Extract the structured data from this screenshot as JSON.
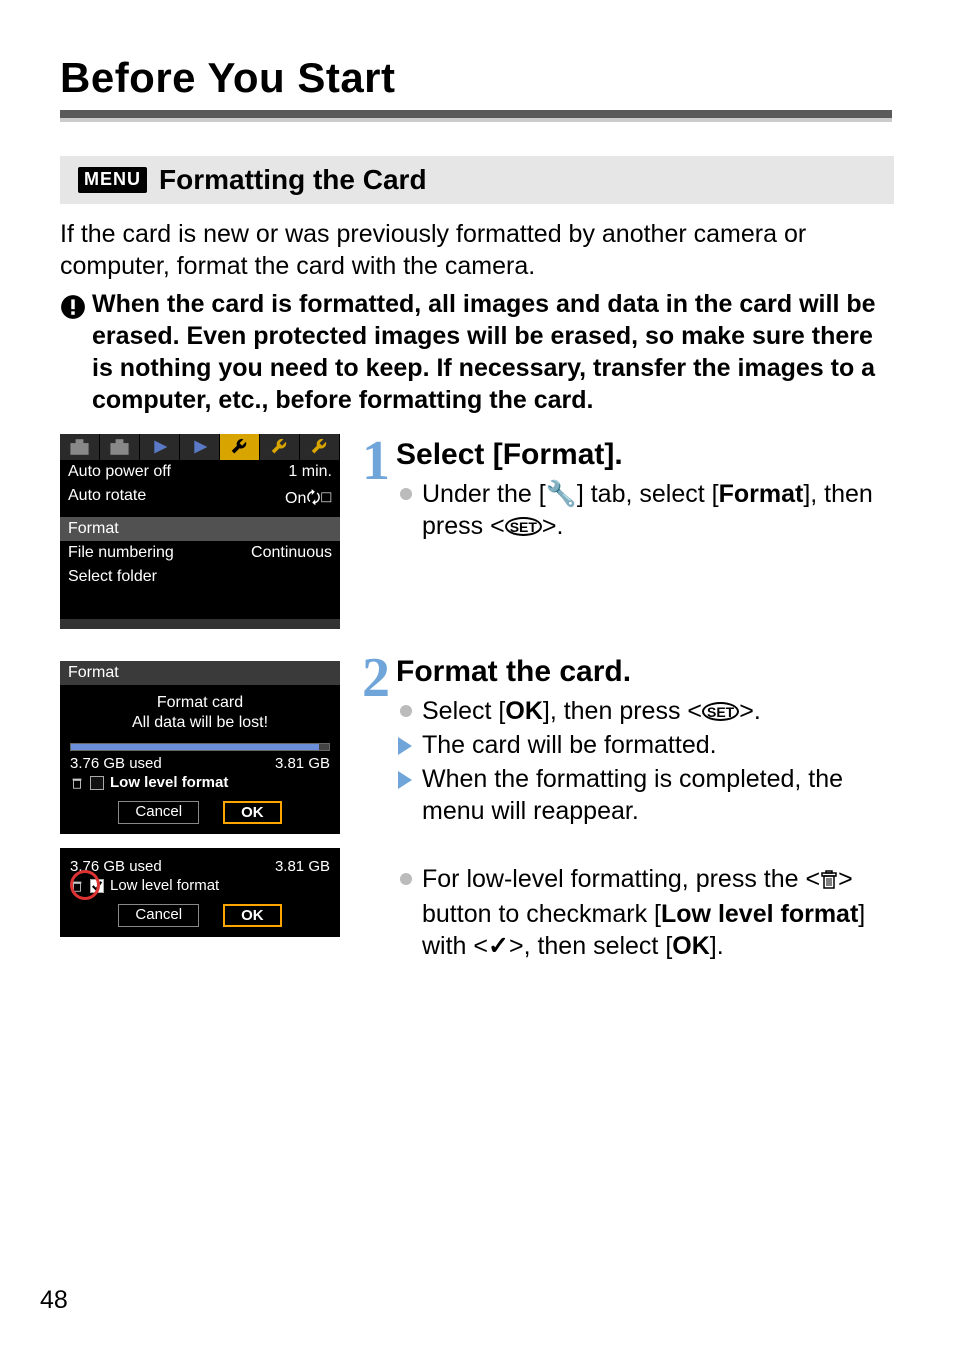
{
  "page": {
    "main_title": "Before You Start",
    "page_number": "48"
  },
  "section": {
    "badge": "MENU",
    "title": "Formatting the Card"
  },
  "intro": "If the card is new or was previously formatted by another camera or computer, format the card with the camera.",
  "warning": "When the card is formatted, all images and data in the card will be erased. Even protected images will be erased, so make sure there is nothing you need to keep. If necessary, transfer the images to a computer, etc., before formatting the card.",
  "steps": {
    "s1": {
      "num": "1",
      "title": "Select [Format].",
      "line_pre": "Under the [",
      "line_mid": "] tab, select [",
      "format_word": "Format",
      "line_post": "], then press <",
      "line_end": ">."
    },
    "s2": {
      "num": "2",
      "title": "Format the card.",
      "b1_pre": "Select [",
      "b1_ok": "OK",
      "b1_mid": "], then press <",
      "b1_end": ">.",
      "b2": "The card will be formatted.",
      "b3": "When the formatting is completed, the menu will reappear.",
      "b4_pre": "For low-level formatting, press the <",
      "b4_mid": "> button to checkmark [",
      "b4_llf": "Low level format",
      "b4_mid2": "] with <",
      "b4_mid3": ">, then select [",
      "b4_ok": "OK",
      "b4_end": "]."
    }
  },
  "shot1": {
    "rows": [
      {
        "l": "Auto power off",
        "r": "1 min."
      },
      {
        "l": "Auto rotate",
        "r": "On🗘◻"
      },
      {
        "l": "Format",
        "r": ""
      },
      {
        "l": "File numbering",
        "r": "Continuous"
      },
      {
        "l": "Select folder",
        "r": ""
      }
    ]
  },
  "shot2": {
    "title": "Format",
    "line1": "Format card",
    "line2": "All data will be lost!",
    "used": "3.76 GB used",
    "total": "3.81 GB",
    "llf": "Low level format",
    "cancel": "Cancel",
    "ok": "OK"
  },
  "shot3": {
    "used": "3.76 GB used",
    "total": "3.81 GB",
    "llf": "Low level format",
    "cancel": "Cancel",
    "ok": "OK"
  }
}
